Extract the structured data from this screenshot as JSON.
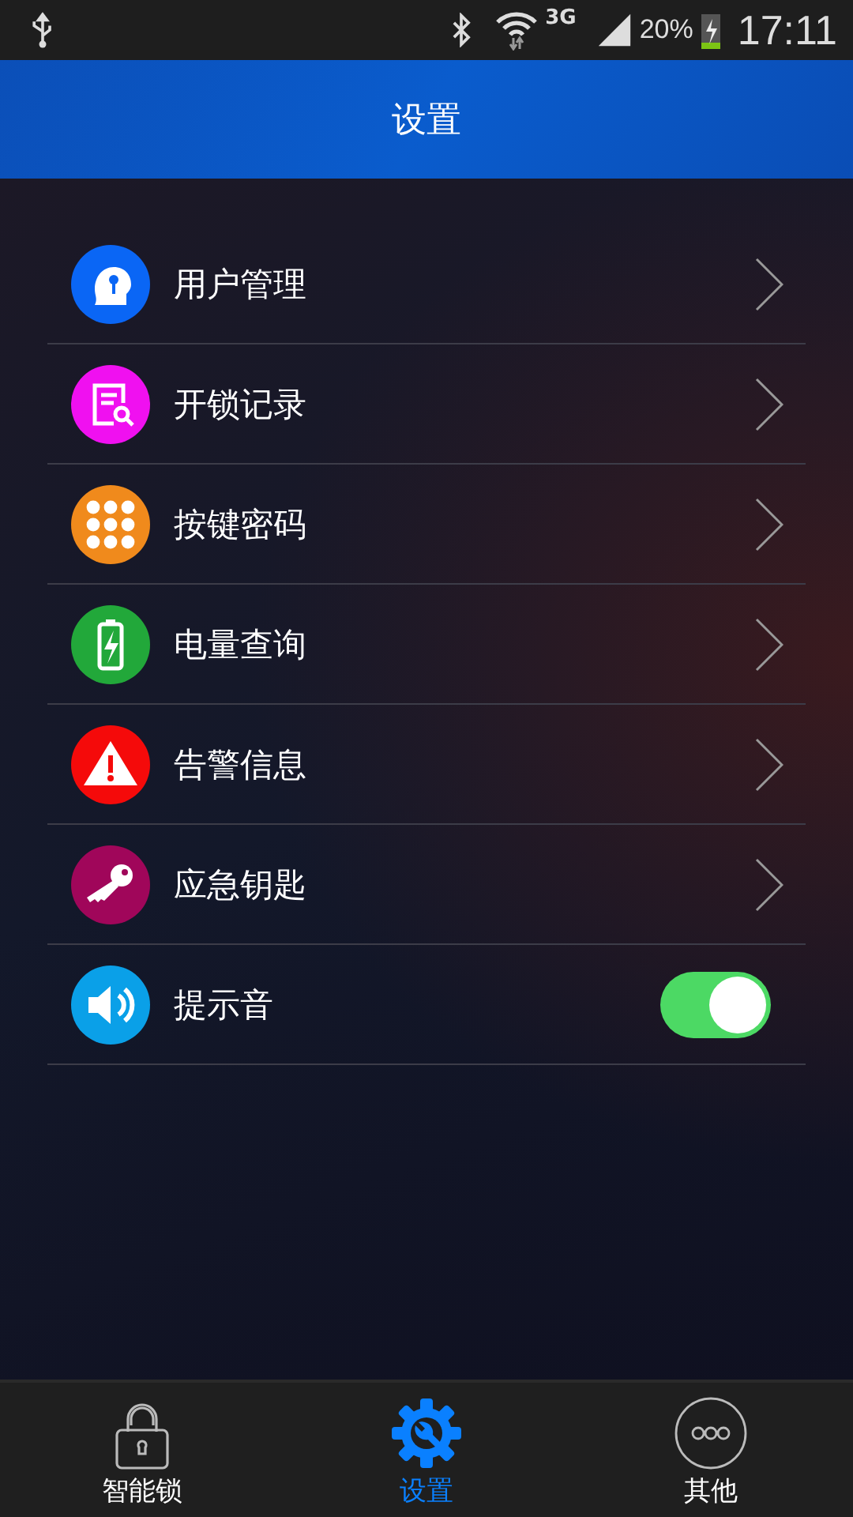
{
  "status_bar": {
    "network": "3G",
    "battery": "20%",
    "time": "17:11"
  },
  "header": {
    "title": "设置"
  },
  "items": [
    {
      "label": "用户管理",
      "kind": "link",
      "color": "#0a66f5"
    },
    {
      "label": "开锁记录",
      "kind": "link",
      "color": "#f010f0"
    },
    {
      "label": "按键密码",
      "kind": "link",
      "color": "#f08a1c"
    },
    {
      "label": "电量查询",
      "kind": "link",
      "color": "#22a83a"
    },
    {
      "label": "告警信息",
      "kind": "link",
      "color": "#f50a0a"
    },
    {
      "label": "应急钥匙",
      "kind": "link",
      "color": "#a0065a"
    },
    {
      "label": "提示音",
      "kind": "toggle",
      "color": "#0aa0e8",
      "on": true
    }
  ],
  "tabs": [
    {
      "label": "智能锁",
      "selected": false
    },
    {
      "label": "设置",
      "selected": true
    },
    {
      "label": "其他",
      "selected": false
    }
  ]
}
